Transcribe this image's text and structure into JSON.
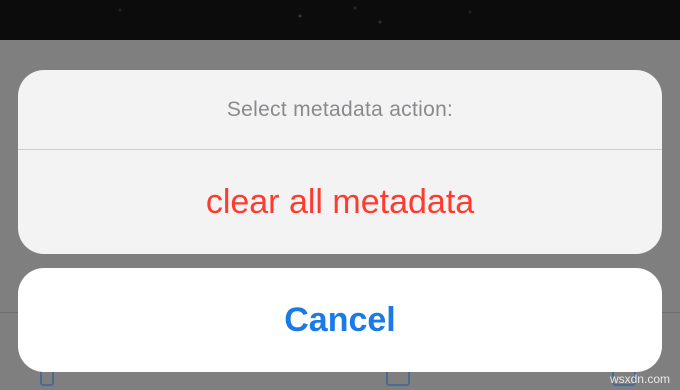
{
  "action_sheet": {
    "title": "Select metadata action:",
    "actions": [
      {
        "label": "clear all metadata",
        "style": "destructive",
        "color": "#ff3b30"
      }
    ],
    "cancel_label": "Cancel",
    "cancel_color": "#1a7be6"
  },
  "watermark": "wsxdn.com"
}
